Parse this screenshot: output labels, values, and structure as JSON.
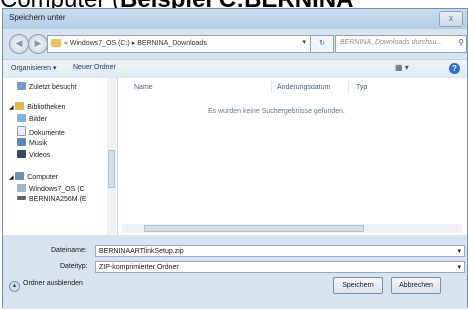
{
  "heading": {
    "part1": "Computer (",
    "part2": "Beispiel C:BERNINA"
  },
  "window": {
    "title": "Speichern unter",
    "close_label": "x"
  },
  "nav": {
    "address_prefix": "«",
    "address_path": [
      "Windows7_OS (C:)",
      "BERNINA_Downloads"
    ],
    "search_placeholder": "BERNINA_Downloads durchsu..."
  },
  "toolbar": {
    "organize": "Organisieren ▾",
    "new_folder": "Neuer Ordner"
  },
  "sidebar": {
    "items": [
      {
        "label": "Zuletzt besucht",
        "icon": "recent-places-icon"
      },
      {
        "label": "Bibliotheken",
        "icon": "libraries-icon"
      },
      {
        "label": "Bilder",
        "icon": "pictures-icon"
      },
      {
        "label": "Dokumente",
        "icon": "documents-icon"
      },
      {
        "label": "Musik",
        "icon": "music-icon"
      },
      {
        "label": "Videos",
        "icon": "videos-icon"
      },
      {
        "label": "Computer",
        "icon": "computer-icon"
      },
      {
        "label": "Windows7_OS (C",
        "icon": "drive-c-icon"
      },
      {
        "label": "BERNINA256M (E",
        "icon": "usb-drive-icon"
      }
    ]
  },
  "filelist": {
    "columns": [
      "Name",
      "Änderungsdatum",
      "Typ"
    ],
    "empty_message": "Es wurden keine Suchergebnisse gefunden."
  },
  "form": {
    "filename_label": "Dateiname:",
    "filename_value": "BERNINAARTlinkSetup.zip",
    "filetype_label": "Dateityp:",
    "filetype_value": "ZIP-komprimierter Ordner"
  },
  "footer": {
    "hide_folders": "Ordner ausblenden",
    "save": "Speichern",
    "cancel": "Abbrechen"
  },
  "colors": {
    "accent": "#2c6fc4",
    "window_bg": "#d7e3ee"
  }
}
